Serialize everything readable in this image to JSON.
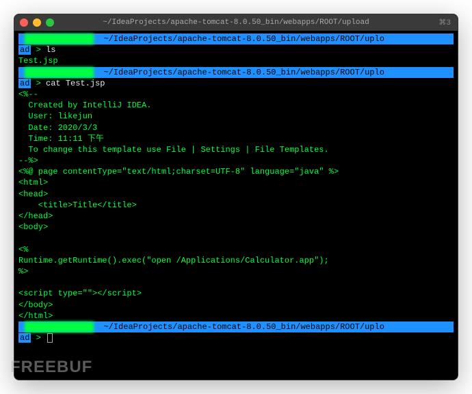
{
  "window": {
    "title": "~/IdeaProjects/apache-tomcat-8.0.50_bin/webapps/ROOT/upload",
    "shortcut_hint": "⌘3"
  },
  "prompt": {
    "user_masked": "███████",
    "host_masked": "██████",
    "path": "~/IdeaProjects/apache-tomcat-8.0.50_bin/webapps/ROOT/uplo",
    "cont": "ad",
    "arrow": ">"
  },
  "session": [
    {
      "type": "prompt"
    },
    {
      "type": "cmd",
      "text": "ls"
    },
    {
      "type": "out",
      "text": "Test.jsp"
    },
    {
      "type": "prompt"
    },
    {
      "type": "cmd",
      "text": "cat Test.jsp"
    },
    {
      "type": "out",
      "text": "<%--"
    },
    {
      "type": "out",
      "text": "  Created by IntelliJ IDEA."
    },
    {
      "type": "out",
      "text": "  User: likejun"
    },
    {
      "type": "out",
      "text": "  Date: 2020/3/3"
    },
    {
      "type": "out",
      "text": "  Time: 11:11 下午"
    },
    {
      "type": "out",
      "text": "  To change this template use File | Settings | File Templates."
    },
    {
      "type": "out",
      "text": "--%>"
    },
    {
      "type": "out",
      "text": "<%@ page contentType=\"text/html;charset=UTF-8\" language=\"java\" %>"
    },
    {
      "type": "out",
      "text": "<html>"
    },
    {
      "type": "out",
      "text": "<head>"
    },
    {
      "type": "out",
      "text": "    <title>Title</title>"
    },
    {
      "type": "out",
      "text": "</head>"
    },
    {
      "type": "out",
      "text": "<body>"
    },
    {
      "type": "out",
      "text": ""
    },
    {
      "type": "out",
      "text": "<%"
    },
    {
      "type": "out",
      "text": "Runtime.getRuntime().exec(\"open /Applications/Calculator.app\");"
    },
    {
      "type": "out",
      "text": "%>"
    },
    {
      "type": "out",
      "text": ""
    },
    {
      "type": "out",
      "text": "<script type=\"\"></script>"
    },
    {
      "type": "out",
      "text": "</body>"
    },
    {
      "type": "out",
      "text": "</html>"
    },
    {
      "type": "prompt"
    },
    {
      "type": "cmd_cursor"
    }
  ],
  "watermark": "FREEBUF"
}
